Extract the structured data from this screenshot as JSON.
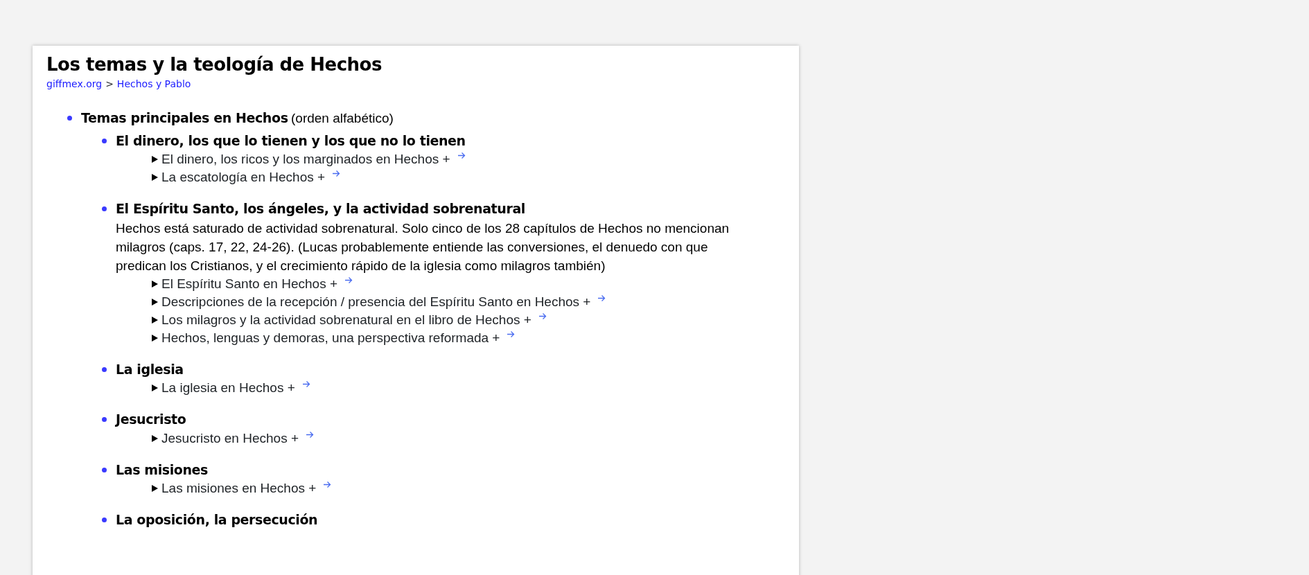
{
  "page_title": "Los temas y la teología de Hechos",
  "breadcrumb": [
    {
      "text": "giffmex.org",
      "kind": "link"
    },
    {
      "text": ">",
      "kind": "separator"
    },
    {
      "text": "Hechos y Pablo",
      "kind": "link"
    }
  ],
  "outline": [
    {
      "heading": "Temas principales en Hechos",
      "note": "(orden alfabético)",
      "children": [
        {
          "heading": "El dinero, los que lo tienen y los que no lo tienen",
          "entries": [
            {
              "label": "El dinero, los ricos y los marginados en Hechos +",
              "expanded": false
            },
            {
              "label": "La escatología en Hechos +",
              "expanded": false
            }
          ]
        },
        {
          "heading": "El Espíritu Santo, los ángeles, y la actividad sobrenatural",
          "description": "Hechos está saturado de actividad sobrenatural. Solo cinco de los 28 capítulos de Hechos no mencionan milagros (caps. 17, 22, 24-26). (Lucas probablemente entiende las conversiones, el denuedo con que predican los Cristianos, y el crecimiento rápido de la iglesia como milagros también)",
          "entries": [
            {
              "label": "El Espíritu Santo en Hechos +",
              "expanded": false
            },
            {
              "label": "Descripciones de la recepción / presencia del Espíritu Santo en Hechos +",
              "expanded": false
            },
            {
              "label": "Los milagros y la actividad sobrenatural en el libro de Hechos +",
              "expanded": false
            },
            {
              "label": "Hechos, lenguas y demoras, una perspectiva reformada +",
              "expanded": false
            }
          ]
        },
        {
          "heading": "La iglesia",
          "entries": [
            {
              "label": "La iglesia en Hechos +",
              "expanded": false
            }
          ]
        },
        {
          "heading": "Jesucristo",
          "entries": [
            {
              "label": "Jesucristo en Hechos +",
              "expanded": false
            }
          ]
        },
        {
          "heading": "Las misiones",
          "entries": [
            {
              "label": "Las misiones en Hechos +",
              "expanded": false
            }
          ]
        },
        {
          "heading": "La oposición, la persecución"
        }
      ]
    }
  ]
}
